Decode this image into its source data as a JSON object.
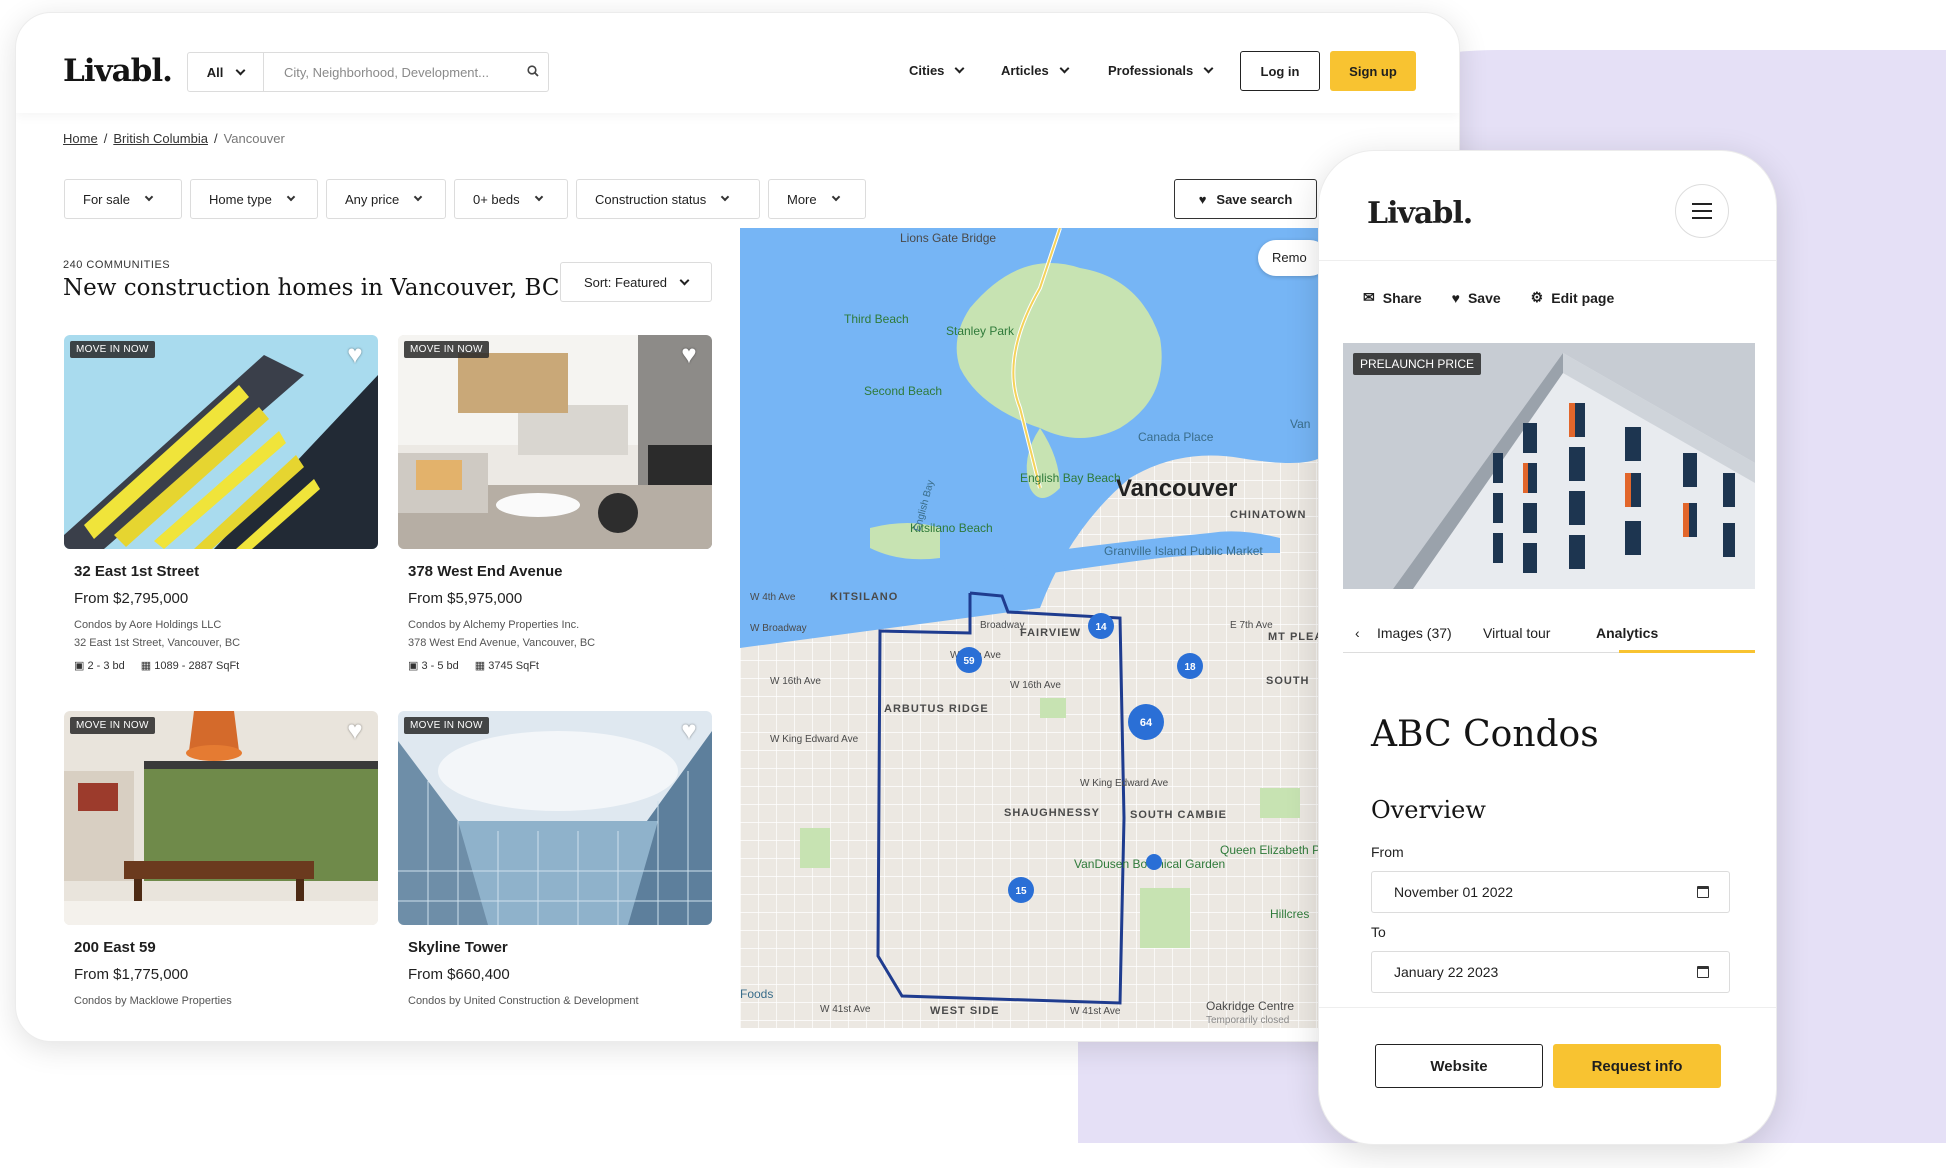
{
  "colors": {
    "accent": "#f8c331",
    "backdrop": "#e5e0f6",
    "map_water": "#76b5f5",
    "map_park": "#c7e3b2",
    "cluster": "#2a6fd6",
    "boundary": "#1f3c8f"
  },
  "header": {
    "logo": "Livabl.",
    "search": {
      "scope": "All",
      "placeholder": "City, Neighborhood, Development..."
    },
    "nav": [
      "Cities",
      "Articles",
      "Professionals"
    ],
    "login": "Log in",
    "signup": "Sign up"
  },
  "breadcrumb": {
    "home": "Home",
    "province": "British Columbia",
    "city": "Vancouver",
    "sep": "/"
  },
  "filters": [
    "For sale",
    "Home type",
    "Any price",
    "0+ beds",
    "Construction status",
    "More"
  ],
  "save_search": "Save search",
  "listing": {
    "count": "240 COMMUNITIES",
    "title": "New construction homes in Vancouver, BC",
    "sort": "Sort: Featured"
  },
  "cards": [
    {
      "badge": "MOVE IN NOW",
      "name": "32 East 1st Street",
      "price": "From $2,795,000",
      "developer": "Condos by Aore Holdings LLC",
      "address": "32 East 1st Street, Vancouver, BC",
      "beds": "2 - 3 bd",
      "sqft": "1089 - 2887 SqFt"
    },
    {
      "badge": "MOVE IN NOW",
      "name": "378 West End Avenue",
      "price": "From $5,975,000",
      "developer": "Condos by Alchemy Properties Inc.",
      "address": "378 West End Avenue, Vancouver, BC",
      "beds": "3 - 5 bd",
      "sqft": "3745 SqFt"
    },
    {
      "badge": "MOVE IN NOW",
      "name": "200 East 59",
      "price": "From $1,775,000",
      "developer": "Condos by Macklowe Properties",
      "address": "",
      "beds": "",
      "sqft": ""
    },
    {
      "badge": "MOVE IN NOW",
      "name": "Skyline Tower",
      "price": "From $660,400",
      "developer": "Condos by United Construction & Development",
      "address": "",
      "beds": "",
      "sqft": ""
    }
  ],
  "map": {
    "remove_label": "Remo",
    "labels": {
      "lions_gate": "Lions Gate Bridge",
      "third_beach": "Third Beach",
      "stanley_park": "Stanley Park",
      "second_beach": "Second Beach",
      "canada_place": "Canada Place",
      "english_bay": "English Bay Beach",
      "vancouver": "Vancouver",
      "chinatown": "CHINATOWN",
      "kitsilano_beach": "Kitsilano Beach",
      "granville": "Granville Island Public Market",
      "kitsilano": "KITSILANO",
      "fairview": "FAIRVIEW",
      "mt_pleasant": "MT PLEA",
      "south": "SOUTH",
      "arbutus": "ARBUTUS RIDGE",
      "shaughnessy": "SHAUGHNESSY",
      "south_cambie": "SOUTH CAMBIE",
      "queen_elizabeth": "Queen Elizabeth Park",
      "vandusen": "VanDusen Botanical Garden",
      "west_side": "WEST SIDE",
      "oakridge": "Oakridge Centre",
      "oakridge_sub": "Temporarily closed",
      "foods": "Foods",
      "hillcrest": "Hillcres",
      "english_bay_water": "English Bay",
      "van": "Van"
    },
    "streets": [
      "W 4th Ave",
      "W Broadway",
      "W 12th Ave",
      "W 16th Ave",
      "W King Edward Ave",
      "W 41st Ave",
      "Broadway",
      "E 7th Ave",
      "W 16th Ave",
      "W King Edward Ave",
      "W 41st Ave"
    ],
    "clusters": [
      {
        "label": "14"
      },
      {
        "label": "59"
      },
      {
        "label": "18"
      },
      {
        "label": "64"
      },
      {
        "label": "15"
      }
    ]
  },
  "phone": {
    "logo": "Livabl.",
    "actions": {
      "share": "Share",
      "save": "Save",
      "edit": "Edit page"
    },
    "hero_badge": "PRELAUNCH PRICE",
    "tabs": [
      "Images (37)",
      "Virtual tour",
      "Analytics"
    ],
    "active_tab": "Analytics",
    "title": "ABC Condos",
    "section": "Overview",
    "from_label": "From",
    "from_value": "November 01 2022",
    "to_label": "To",
    "to_value": "January 22 2023",
    "website": "Website",
    "request": "Request info"
  }
}
